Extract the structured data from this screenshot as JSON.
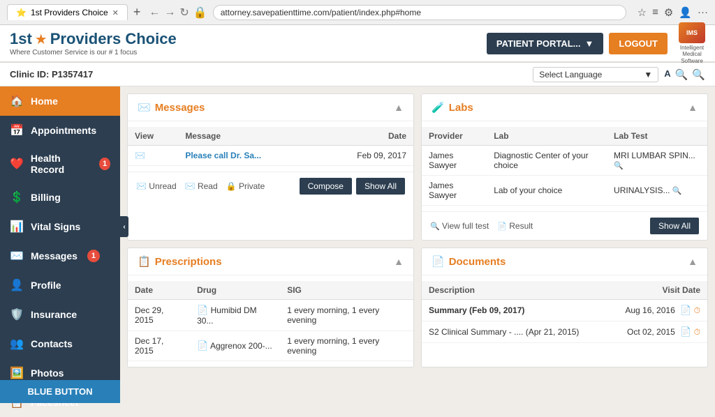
{
  "browser": {
    "tab_title": "1st Providers Choice",
    "url": "attorney.savepatienttime.com/patient/index.php#home",
    "lock_icon": "🔒"
  },
  "app": {
    "logo_text_1": "1st",
    "logo_text_2": "Providers Choice",
    "logo_tagline": "Where Customer Service is our # 1 focus",
    "ims_line1": "Intelligent",
    "ims_line2": "Medical",
    "ims_line3": "Software",
    "btn_portal": "PATIENT PORTAL...",
    "btn_logout": "LOGOUT"
  },
  "clinic_bar": {
    "label": "Clinic ID:",
    "clinic_id": "P1357417",
    "lang_placeholder": "Select Language"
  },
  "sidebar": {
    "items": [
      {
        "label": "Home",
        "icon": "🏠",
        "active": true
      },
      {
        "label": "Appointments",
        "icon": "📅",
        "active": false
      },
      {
        "label": "Health Record",
        "icon": "❤️",
        "active": false,
        "badge": "1"
      },
      {
        "label": "Billing",
        "icon": "💲",
        "active": false
      },
      {
        "label": "Vital Signs",
        "icon": "📊",
        "active": false
      },
      {
        "label": "Messages",
        "icon": "✉️",
        "active": false,
        "badge": "1"
      },
      {
        "label": "Profile",
        "icon": "👤",
        "active": false
      },
      {
        "label": "Insurance",
        "icon": "🛡️",
        "active": false
      },
      {
        "label": "Contacts",
        "icon": "👥",
        "active": false
      },
      {
        "label": "Photos",
        "icon": "🖼️",
        "active": false
      },
      {
        "label": "Facesheet",
        "icon": "📋",
        "active": false
      }
    ],
    "blue_button": "BLUE BUTTON"
  },
  "messages_card": {
    "title": "Messages",
    "icon": "✉️",
    "columns": [
      "View",
      "Message",
      "Date"
    ],
    "rows": [
      {
        "view_icon": "✉️",
        "message": "Please call Dr. Sa...",
        "date": "Feb 09, 2017"
      }
    ],
    "footer": {
      "unread": "Unread",
      "read": "Read",
      "private": "Private",
      "compose": "Compose",
      "show_all": "Show All"
    }
  },
  "labs_card": {
    "title": "Labs",
    "icon": "🧪",
    "columns": [
      "Provider",
      "Lab",
      "Lab Test"
    ],
    "rows": [
      {
        "provider": "James Sawyer",
        "lab": "Diagnostic Center of your choice",
        "lab_test": "MRI LUMBAR SPIN..."
      },
      {
        "provider": "James Sawyer",
        "lab": "Lab of your choice",
        "lab_test": "URINALYSIS..."
      }
    ],
    "footer": {
      "view_full_test": "View full test",
      "result": "Result",
      "show_all": "Show All"
    }
  },
  "prescriptions_card": {
    "title": "Prescriptions",
    "icon": "📋",
    "columns": [
      "Date",
      "Drug",
      "SIG"
    ],
    "rows": [
      {
        "date": "Dec 29, 2015",
        "drug": "Humibid DM 30...",
        "sig": "1 every morning, 1 every evening"
      },
      {
        "date": "Dec 17, 2015",
        "drug": "Aggrenox 200-...",
        "sig": "1 every morning, 1 every evening"
      }
    ]
  },
  "documents_card": {
    "title": "Documents",
    "icon": "📄",
    "columns": [
      "Description",
      "Visit Date"
    ],
    "rows": [
      {
        "description": "Summary (Feb 09, 2017)",
        "visit_date": "Aug 16, 2016"
      },
      {
        "description": "S2 Clinical Summary - .... (Apr 21, 2015)",
        "visit_date": "Oct 02, 2015"
      }
    ]
  }
}
